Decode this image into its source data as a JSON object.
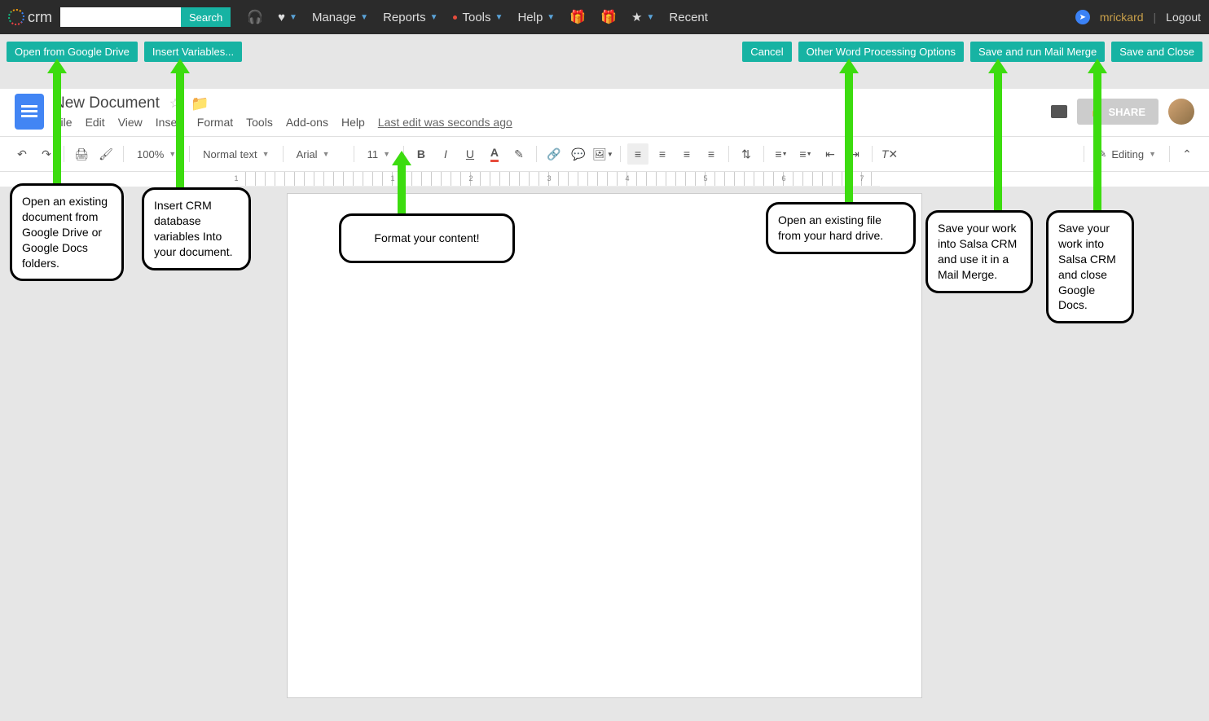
{
  "crm": {
    "logo_text": "crm",
    "search_placeholder": "",
    "search_btn": "Search",
    "nav": {
      "manage": "Manage",
      "reports": "Reports",
      "tools": "Tools",
      "help": "Help",
      "recent": "Recent"
    },
    "user": "mrickard",
    "logout": "Logout"
  },
  "actions": {
    "open_drive": "Open from Google Drive",
    "insert_vars": "Insert Variables...",
    "cancel": "Cancel",
    "other_wp": "Other Word Processing Options",
    "save_mail": "Save and run Mail Merge",
    "save_close": "Save and Close"
  },
  "docs": {
    "title": "New Document",
    "menus": {
      "file": "File",
      "edit": "Edit",
      "view": "View",
      "insert": "Insert",
      "format": "Format",
      "tools": "Tools",
      "addons": "Add-ons",
      "help": "Help"
    },
    "last_edit": "Last edit was seconds ago",
    "share": "SHARE",
    "toolbar": {
      "zoom": "100%",
      "style": "Normal text",
      "font": "Arial",
      "size": "11",
      "editing": "Editing"
    },
    "ruler_numbers": [
      "1",
      "1",
      "2",
      "3",
      "4",
      "5",
      "6",
      "7"
    ]
  },
  "callouts": {
    "c1": "Open an existing document from Google Drive or Google Docs folders.",
    "c2": "Insert CRM database variables Into your document.",
    "c3": "Format your content!",
    "c4": "Open an existing file from your hard drive.",
    "c5": "Save your work into Salsa CRM and use it in a Mail Merge.",
    "c6": "Save your work into Salsa CRM and close Google Docs."
  }
}
